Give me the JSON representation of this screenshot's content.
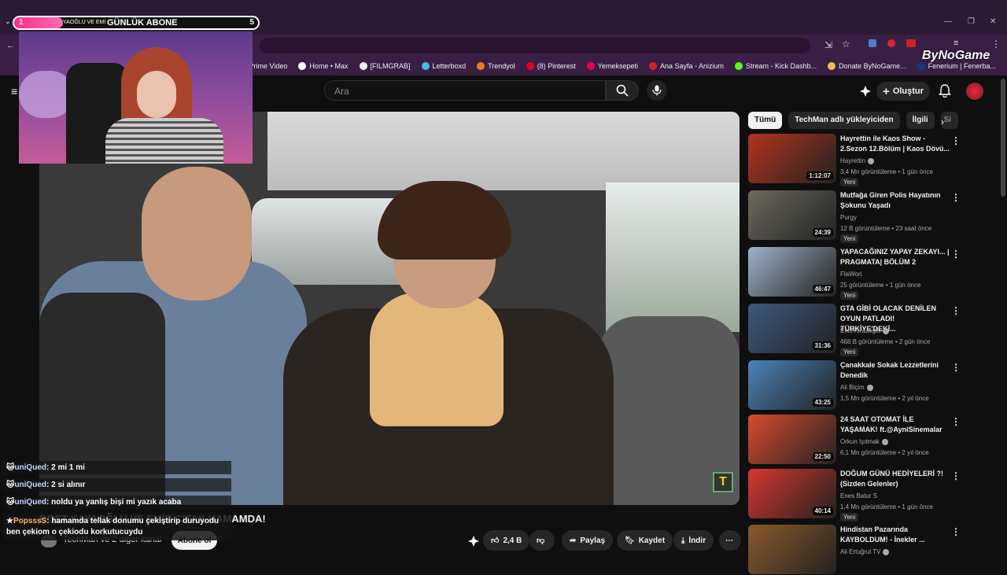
{
  "overlay": {
    "goal": {
      "current": "1",
      "target": "5",
      "progress": 0.2,
      "scroll_text": "YAOĞLU VE EMİ",
      "label": "GÜNLÜK ABONE"
    },
    "brand_logo": "ByNoGame"
  },
  "browser": {
    "bookmarks": [
      {
        "label": "Prime Video",
        "color": "#1f7bd6"
      },
      {
        "label": "Home • Max",
        "color": "#ffffff"
      },
      {
        "label": "[FILMGRAB]",
        "color": "#eeeeee"
      },
      {
        "label": "Letterboxd",
        "color": "#40bcf4"
      },
      {
        "label": "Trendyol",
        "color": "#f27a1a"
      },
      {
        "label": "(8) Pinterest",
        "color": "#e60023"
      },
      {
        "label": "Yemeksepeti",
        "color": "#ea004b"
      },
      {
        "label": "Ana Sayfa - Anizium",
        "color": "#d91e2c"
      },
      {
        "label": "Stream - Kick Dashb...",
        "color": "#53fc18"
      },
      {
        "label": "Donate ByNoGame...",
        "color": "#f2c14e"
      },
      {
        "label": "Fenerium | Fenerba...",
        "color": "#0a3a8c"
      }
    ]
  },
  "youtube": {
    "search_placeholder": "Ara",
    "create_label": "Oluştur"
  },
  "video": {
    "title": "BOST KAYAOĞLU VE EMİR ÇITAK HAMAMDA!",
    "channel": "TechMan ve 2 diğer kanal",
    "subscribe_label": "Abone ol",
    "likes": "2,4 B",
    "share_label": "Paylaş",
    "save_label": "Kaydet",
    "download_label": "İndir"
  },
  "chat": [
    {
      "user": "uniQued",
      "message": "2 mi 1 mi"
    },
    {
      "user": "uniQued",
      "message": "2 si alınır"
    },
    {
      "user": "uniQued",
      "message": "noldu ya yanlış bişi mi yazık acaba"
    },
    {
      "user": "PopsssS",
      "message": "hamamda tellak donumu çekiştirip duruyodu ben çekiom o çekiodu korkutucuydu"
    }
  ],
  "chips": [
    "Tümü",
    "TechMan adlı yükleyiciden",
    "İlgili",
    "Si"
  ],
  "recommendations": [
    {
      "title": "Hayrettin ile Kaos Show - 2.Sezon 12.Bölüm | Kaos Dövü...",
      "channel": "Hayrettin",
      "verified": true,
      "meta": "3,4 Mn görüntüleme • 1 gün önce",
      "duration": "1:12:07",
      "badge": "Yeni",
      "color": "#b3341e"
    },
    {
      "title": "Mutfağa Giren Polis Hayatının Şokunu Yaşadı",
      "channel": "Purgy",
      "verified": false,
      "meta": "12 B görüntüleme • 23 saat önce",
      "duration": "24:39",
      "badge": "Yeni",
      "color": "#6c6a5e"
    },
    {
      "title": "YAPACAĞINIZ YAPAY ZEKAYI... | PRAGMATA| BÖLÜM 2",
      "channel": "FlaWori",
      "verified": false,
      "meta": "25 görüntüleme • 1 gün önce",
      "duration": "46:47",
      "badge": "Yeni",
      "color": "#9fb2c8"
    },
    {
      "title": "GTA GİBİ OLACAK DENİLEN OYUN PATLADI! TÜRKİYE'DEKİ...",
      "channel": "Enis Kirazoglu",
      "verified": true,
      "meta": "468 B görüntüleme • 2 gün önce",
      "duration": "31:36",
      "badge": "Yeni",
      "color": "#3d5a80"
    },
    {
      "title": "Çanakkale Sokak Lezzetlerini Denedik",
      "channel": "Ali Biçim",
      "verified": true,
      "meta": "1,5 Mn görüntüleme • 2 yıl önce",
      "duration": "43:25",
      "badge": "",
      "color": "#4a84b8"
    },
    {
      "title": "24 SAAT OTOMAT İLE YAŞAMAK! ft.@AyniSinemalar",
      "channel": "Orkun Işıtmak",
      "verified": true,
      "meta": "6,1 Mn görüntüleme • 2 yıl önce",
      "duration": "22:50",
      "badge": "",
      "color": "#d94b2e"
    },
    {
      "title": "DOĞUM GÜNÜ HEDİYELERİ ?! (Sizden Gelenler)",
      "channel": "Enes Batur S",
      "verified": false,
      "meta": "1,4 Mn görüntüleme • 1 gün önce",
      "duration": "40:14",
      "badge": "Yeni",
      "color": "#d8372f"
    },
    {
      "title": "Hindistan Pazarında KAYBOLDUM! - İnekler ...",
      "channel": "Ali Ertuğrul TV",
      "verified": true,
      "meta": "",
      "duration": "",
      "badge": "",
      "color": "#8a5a2a"
    }
  ]
}
